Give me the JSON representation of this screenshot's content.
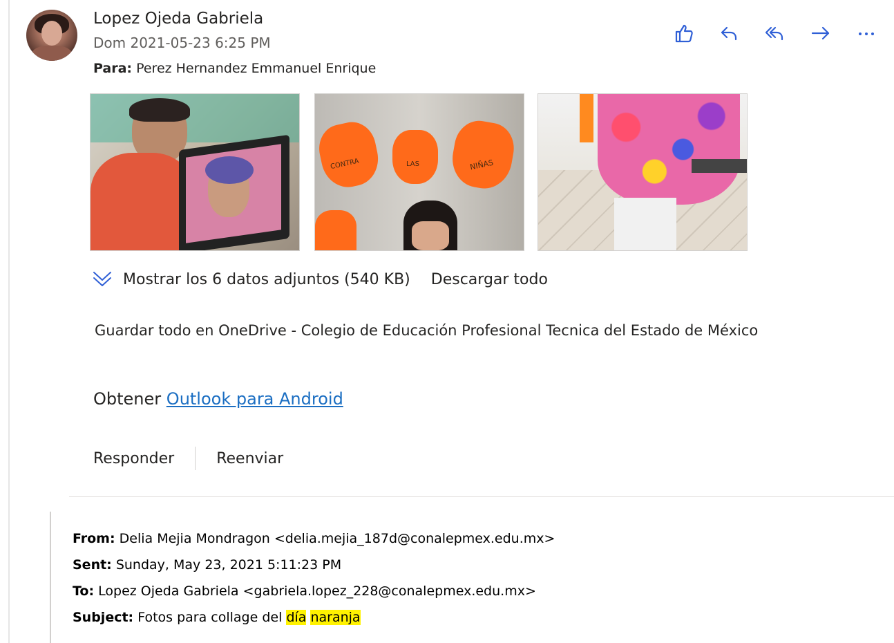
{
  "message": {
    "sender_name": "Lopez Ojeda Gabriela",
    "date": "Dom 2021-05-23 6:25 PM",
    "to_label": "Para:",
    "to_value": "Perez Hernandez Emmanuel Enrique"
  },
  "actions": {
    "like": "thumbs-up-icon",
    "reply": "reply-icon",
    "reply_all": "reply-all-icon",
    "forward": "forward-icon",
    "more": "more-icon"
  },
  "attachments": {
    "show_all": "Mostrar los 6 datos adjuntos (540 KB)",
    "download_all": "Descargar todo",
    "thumb2_labels": [
      "CONTRA",
      "LAS",
      "NIÑAS"
    ]
  },
  "body": {
    "onedrive": "Guardar todo en OneDrive - Colegio de Educación Profesional Tecnica del Estado de México",
    "obtener": "Obtener",
    "android_link": "Outlook para Android"
  },
  "footer_actions": {
    "reply": "Responder",
    "forward": "Reenviar"
  },
  "quoted": {
    "from_label": "From:",
    "from_value": "Delia Mejia Mondragon <delia.mejia_187d@conalepmex.edu.mx>",
    "sent_label": "Sent:",
    "sent_value": "Sunday, May 23, 2021 5:11:23 PM",
    "to_label": "To:",
    "to_value": "Lopez Ojeda Gabriela <gabriela.lopez_228@conalepmex.edu.mx>",
    "subject_label": "Subject:",
    "subject_prefix": "Fotos para collage del",
    "subject_hl1": "día",
    "subject_hl2": "naranja"
  },
  "colors": {
    "accent": "#2f5fd6",
    "link": "#1b6ec2",
    "highlight": "#fff200"
  }
}
